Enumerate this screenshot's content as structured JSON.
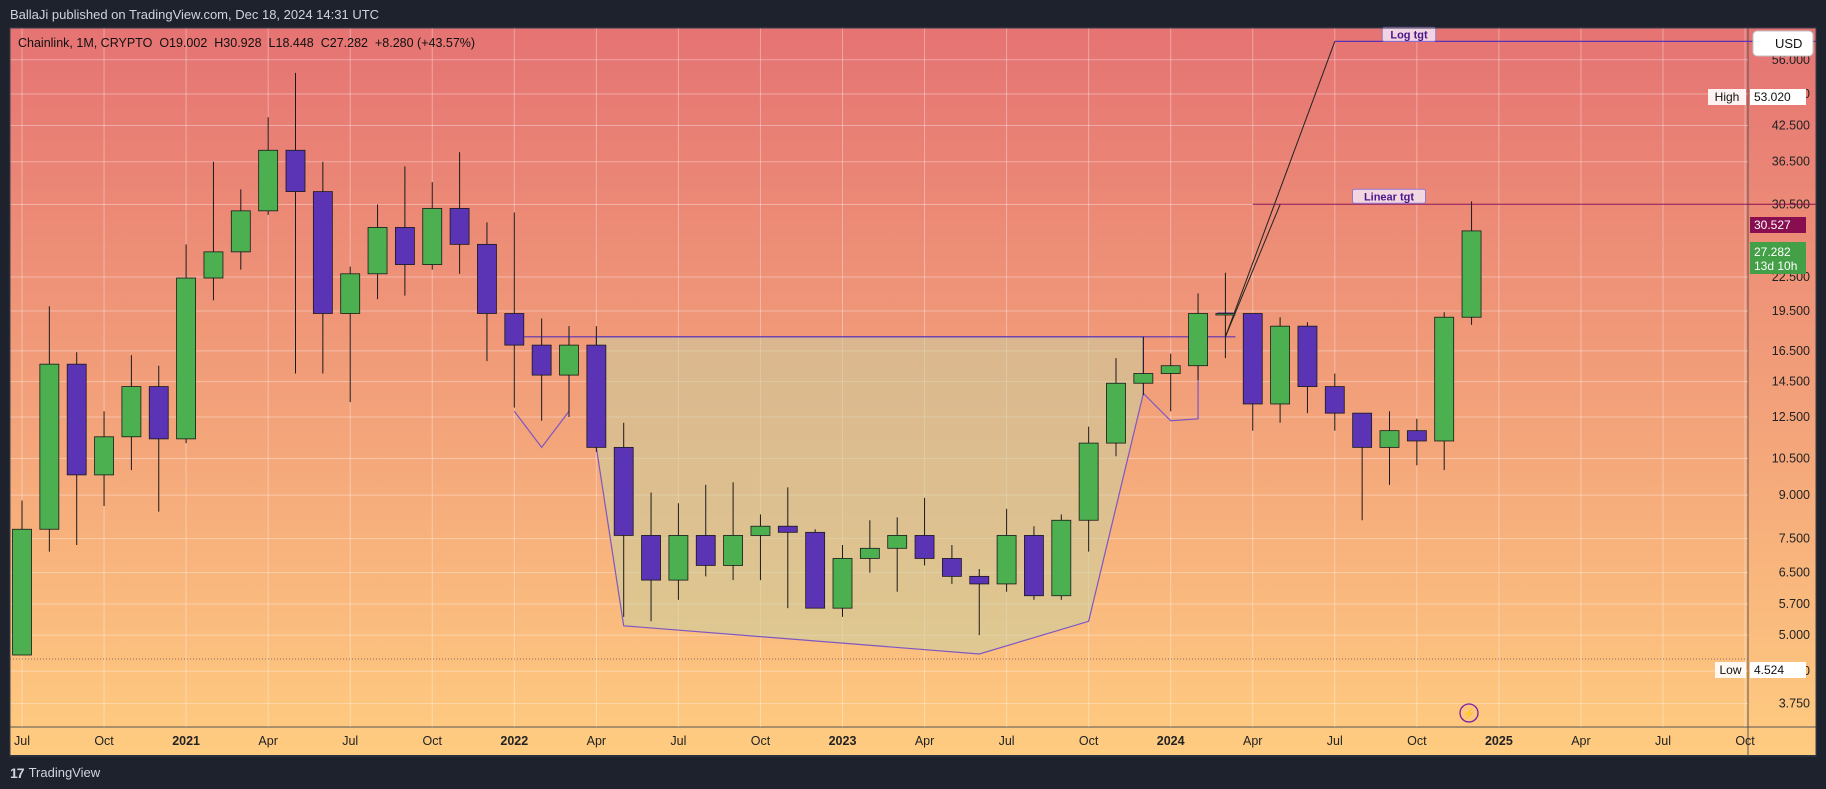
{
  "header": {
    "publisher": "BallaJi published on TradingView.com, Dec 18, 2024 14:31 UTC"
  },
  "footer": {
    "brand_mark": "17",
    "brand": "TradingView"
  },
  "legend": {
    "symbol": "Chainlink, 1M, CRYPTO",
    "open": "O19.002",
    "high": "H30.928",
    "low": "L18.448",
    "close": "C27.282",
    "change": "+8.280 (+43.57%)"
  },
  "currency_button": "USD",
  "badges": {
    "high_label": "High",
    "high_value": "53.020",
    "low_label": "Low",
    "low_value": "4.524",
    "target_value": "30.527",
    "last_price": "27.282",
    "countdown": "13d 10h"
  },
  "annotations": {
    "log_target": "Log tgt",
    "linear_target": "Linear tgt"
  },
  "colors": {
    "up": "#4caf50",
    "down": "#5b33b5",
    "wick": "#1a1a1a",
    "bg_top": "#e57373",
    "bg_bottom": "#ffcc80",
    "cup_fill": "#c8d0a0",
    "cup_line": "#7e57c2",
    "target_badge": "#880e4f",
    "price_badge": "#43a047"
  },
  "chart_data": {
    "type": "candlestick",
    "symbol": "Chainlink",
    "interval": "1M",
    "y_scale": "log",
    "ylim": [
      3.4,
      64
    ],
    "xlim": [
      "2020-06",
      "2025-10"
    ],
    "y_ticks": [
      56.0,
      48.5,
      42.5,
      36.5,
      30.5,
      22.5,
      19.5,
      16.5,
      14.5,
      12.5,
      10.5,
      9.0,
      7.5,
      6.5,
      5.7,
      5.0,
      4.3,
      3.75
    ],
    "y_tick_labels": [
      "56.000",
      "48.500",
      "42.500",
      "36.500",
      "30.500",
      "22.500",
      "19.500",
      "16.500",
      "14.500",
      "12.500",
      "10.500",
      "9.000",
      "7.500",
      "6.500",
      "5.700",
      "5.000",
      "4.300",
      "3.750"
    ],
    "x_ticks": [
      {
        "month": "2020-07",
        "label": "Jul"
      },
      {
        "month": "2020-10",
        "label": "Oct"
      },
      {
        "month": "2021-01",
        "label": "2021"
      },
      {
        "month": "2021-04",
        "label": "Apr"
      },
      {
        "month": "2021-07",
        "label": "Jul"
      },
      {
        "month": "2021-10",
        "label": "Oct"
      },
      {
        "month": "2022-01",
        "label": "2022"
      },
      {
        "month": "2022-04",
        "label": "Apr"
      },
      {
        "month": "2022-07",
        "label": "Jul"
      },
      {
        "month": "2022-10",
        "label": "Oct"
      },
      {
        "month": "2023-01",
        "label": "2023"
      },
      {
        "month": "2023-04",
        "label": "Apr"
      },
      {
        "month": "2023-07",
        "label": "Jul"
      },
      {
        "month": "2023-10",
        "label": "Oct"
      },
      {
        "month": "2024-01",
        "label": "2024"
      },
      {
        "month": "2024-04",
        "label": "Apr"
      },
      {
        "month": "2024-07",
        "label": "Jul"
      },
      {
        "month": "2024-10",
        "label": "Oct"
      },
      {
        "month": "2025-01",
        "label": "2025"
      },
      {
        "month": "2025-04",
        "label": "Apr"
      },
      {
        "month": "2025-07",
        "label": "Jul"
      },
      {
        "month": "2025-10",
        "label": "Oct"
      }
    ],
    "candles": [
      {
        "t": "2020-07",
        "o": 4.6,
        "h": 8.8,
        "l": 4.6,
        "c": 7.8
      },
      {
        "t": "2020-08",
        "o": 7.8,
        "h": 19.9,
        "l": 7.1,
        "c": 15.6
      },
      {
        "t": "2020-09",
        "o": 15.6,
        "h": 16.4,
        "l": 7.3,
        "c": 9.8
      },
      {
        "t": "2020-10",
        "o": 9.8,
        "h": 12.8,
        "l": 8.6,
        "c": 11.5
      },
      {
        "t": "2020-11",
        "o": 11.5,
        "h": 16.2,
        "l": 10.0,
        "c": 14.2
      },
      {
        "t": "2020-12",
        "o": 14.2,
        "h": 15.5,
        "l": 8.4,
        "c": 11.4
      },
      {
        "t": "2021-01",
        "o": 11.4,
        "h": 25.8,
        "l": 11.2,
        "c": 22.4
      },
      {
        "t": "2021-02",
        "o": 22.4,
        "h": 36.5,
        "l": 20.4,
        "c": 25.0
      },
      {
        "t": "2021-03",
        "o": 25.0,
        "h": 32.5,
        "l": 23.2,
        "c": 29.7
      },
      {
        "t": "2021-04",
        "o": 29.7,
        "h": 44.0,
        "l": 29.2,
        "c": 38.3
      },
      {
        "t": "2021-05",
        "o": 38.3,
        "h": 53.0,
        "l": 15.0,
        "c": 32.2
      },
      {
        "t": "2021-06",
        "o": 32.2,
        "h": 36.5,
        "l": 15.0,
        "c": 19.3
      },
      {
        "t": "2021-07",
        "o": 19.3,
        "h": 23.5,
        "l": 13.3,
        "c": 22.8
      },
      {
        "t": "2021-08",
        "o": 22.8,
        "h": 30.5,
        "l": 20.5,
        "c": 27.7
      },
      {
        "t": "2021-09",
        "o": 27.7,
        "h": 35.8,
        "l": 20.8,
        "c": 23.7
      },
      {
        "t": "2021-10",
        "o": 23.7,
        "h": 33.5,
        "l": 23.2,
        "c": 30.0
      },
      {
        "t": "2021-11",
        "o": 30.0,
        "h": 38.0,
        "l": 22.8,
        "c": 25.8
      },
      {
        "t": "2021-12",
        "o": 25.8,
        "h": 28.3,
        "l": 15.8,
        "c": 19.3
      },
      {
        "t": "2022-01",
        "o": 19.3,
        "h": 29.5,
        "l": 13.0,
        "c": 16.9
      },
      {
        "t": "2022-02",
        "o": 16.9,
        "h": 18.9,
        "l": 12.3,
        "c": 14.9
      },
      {
        "t": "2022-03",
        "o": 14.9,
        "h": 18.3,
        "l": 12.5,
        "c": 16.9
      },
      {
        "t": "2022-04",
        "o": 16.9,
        "h": 18.3,
        "l": 10.8,
        "c": 11.0
      },
      {
        "t": "2022-05",
        "o": 11.0,
        "h": 12.2,
        "l": 5.4,
        "c": 7.6
      },
      {
        "t": "2022-06",
        "o": 7.6,
        "h": 9.1,
        "l": 5.3,
        "c": 6.3
      },
      {
        "t": "2022-07",
        "o": 6.3,
        "h": 8.7,
        "l": 5.8,
        "c": 7.6
      },
      {
        "t": "2022-08",
        "o": 7.6,
        "h": 9.4,
        "l": 6.4,
        "c": 6.7
      },
      {
        "t": "2022-09",
        "o": 6.7,
        "h": 9.5,
        "l": 6.3,
        "c": 7.6
      },
      {
        "t": "2022-10",
        "o": 7.6,
        "h": 8.3,
        "l": 6.3,
        "c": 7.9
      },
      {
        "t": "2022-11",
        "o": 7.9,
        "h": 9.3,
        "l": 5.6,
        "c": 7.7
      },
      {
        "t": "2022-12",
        "o": 7.7,
        "h": 7.8,
        "l": 5.6,
        "c": 5.6
      },
      {
        "t": "2023-01",
        "o": 5.6,
        "h": 7.3,
        "l": 5.4,
        "c": 6.9
      },
      {
        "t": "2023-02",
        "o": 6.9,
        "h": 8.1,
        "l": 6.5,
        "c": 7.2
      },
      {
        "t": "2023-03",
        "o": 7.2,
        "h": 8.2,
        "l": 6.0,
        "c": 7.6
      },
      {
        "t": "2023-04",
        "o": 7.6,
        "h": 8.9,
        "l": 6.7,
        "c": 6.9
      },
      {
        "t": "2023-05",
        "o": 6.9,
        "h": 7.3,
        "l": 6.2,
        "c": 6.4
      },
      {
        "t": "2023-06",
        "o": 6.4,
        "h": 6.6,
        "l": 5.0,
        "c": 6.2
      },
      {
        "t": "2023-07",
        "o": 6.2,
        "h": 8.5,
        "l": 6.0,
        "c": 7.6
      },
      {
        "t": "2023-08",
        "o": 7.6,
        "h": 7.9,
        "l": 5.8,
        "c": 5.9
      },
      {
        "t": "2023-09",
        "o": 5.9,
        "h": 8.3,
        "l": 5.8,
        "c": 8.1
      },
      {
        "t": "2023-10",
        "o": 8.1,
        "h": 12.0,
        "l": 7.1,
        "c": 11.2
      },
      {
        "t": "2023-11",
        "o": 11.2,
        "h": 16.0,
        "l": 10.6,
        "c": 14.4
      },
      {
        "t": "2023-12",
        "o": 14.4,
        "h": 17.5,
        "l": 13.7,
        "c": 15.0
      },
      {
        "t": "2024-01",
        "o": 15.0,
        "h": 16.3,
        "l": 12.8,
        "c": 15.5
      },
      {
        "t": "2024-02",
        "o": 15.5,
        "h": 21.0,
        "l": 14.6,
        "c": 19.3
      },
      {
        "t": "2024-03",
        "o": 19.3,
        "h": 22.9,
        "l": 16.0,
        "c": 19.3
      },
      {
        "t": "2024-04",
        "o": 19.3,
        "h": 19.3,
        "l": 11.8,
        "c": 13.2
      },
      {
        "t": "2024-05",
        "o": 13.2,
        "h": 19.0,
        "l": 12.2,
        "c": 18.3
      },
      {
        "t": "2024-06",
        "o": 18.3,
        "h": 18.6,
        "l": 12.7,
        "c": 14.2
      },
      {
        "t": "2024-07",
        "o": 14.2,
        "h": 15.0,
        "l": 11.8,
        "c": 12.7
      },
      {
        "t": "2024-08",
        "o": 12.7,
        "h": 12.7,
        "l": 8.1,
        "c": 11.0
      },
      {
        "t": "2024-09",
        "o": 11.0,
        "h": 12.8,
        "l": 9.4,
        "c": 11.8
      },
      {
        "t": "2024-10",
        "o": 11.8,
        "h": 12.4,
        "l": 10.2,
        "c": 11.3
      },
      {
        "t": "2024-11",
        "o": 11.3,
        "h": 19.4,
        "l": 10.0,
        "c": 19.0
      },
      {
        "t": "2024-12",
        "o": 19.0,
        "h": 30.9,
        "l": 18.4,
        "c": 27.3
      }
    ],
    "lines": {
      "cup_rim": 17.5,
      "linear_target": 30.527,
      "log_target": 60.5,
      "high": 53.02,
      "low": 4.524
    },
    "cup_points": [
      {
        "t": "2022-04",
        "v": 17.5
      },
      {
        "t": "2022-04",
        "v": 11.0
      },
      {
        "t": "2022-05",
        "v": 5.2
      },
      {
        "t": "2023-06",
        "v": 4.62
      },
      {
        "t": "2023-10",
        "v": 5.3
      },
      {
        "t": "2023-12",
        "v": 13.8
      },
      {
        "t": "2023-12",
        "v": 17.5
      }
    ],
    "handle_points": [
      {
        "t": "2022-01",
        "v": 12.8
      },
      {
        "t": "2022-02",
        "v": 11.0
      },
      {
        "t": "2022-03",
        "v": 12.8
      },
      {
        "t": "2022-03",
        "v": 17.5
      }
    ],
    "handle2_points": [
      {
        "t": "2023-12",
        "v": 13.8
      },
      {
        "t": "2024-01",
        "v": 12.3
      },
      {
        "t": "2024-02",
        "v": 12.4
      },
      {
        "t": "2024-02",
        "v": 17.5
      }
    ],
    "projection_log": [
      {
        "t": "2024-03",
        "v": 17.5
      },
      {
        "t": "2024-07",
        "v": 60.5
      }
    ],
    "projection_linear": [
      {
        "t": "2024-03",
        "v": 17.5
      },
      {
        "t": "2024-05",
        "v": 30.5
      }
    ]
  }
}
